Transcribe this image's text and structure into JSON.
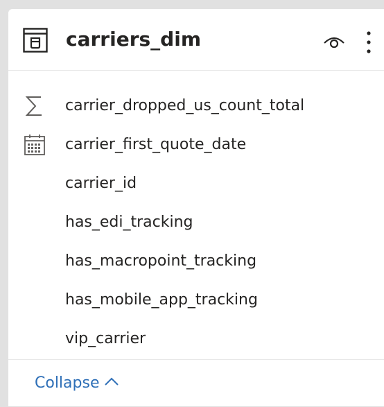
{
  "card": {
    "title": "carriers_dim",
    "icons": {
      "table": "table-icon",
      "visibility": "eye-icon",
      "more": "more-vertical-icon"
    }
  },
  "fields": [
    {
      "label": "carrier_dropped_us_count_total",
      "icon": "sigma-icon"
    },
    {
      "label": "carrier_first_quote_date",
      "icon": "calendar-icon"
    },
    {
      "label": "carrier_id",
      "icon": ""
    },
    {
      "label": "has_edi_tracking",
      "icon": ""
    },
    {
      "label": "has_macropoint_tracking",
      "icon": ""
    },
    {
      "label": "has_mobile_app_tracking",
      "icon": ""
    },
    {
      "label": "vip_carrier",
      "icon": ""
    }
  ],
  "footer": {
    "collapse_label": "Collapse",
    "icon": "chevron-up-icon"
  },
  "colors": {
    "background": "#e1e1e1",
    "card": "#ffffff",
    "text": "#252423",
    "link": "#2e6fb7",
    "icon": "#605e5c"
  }
}
